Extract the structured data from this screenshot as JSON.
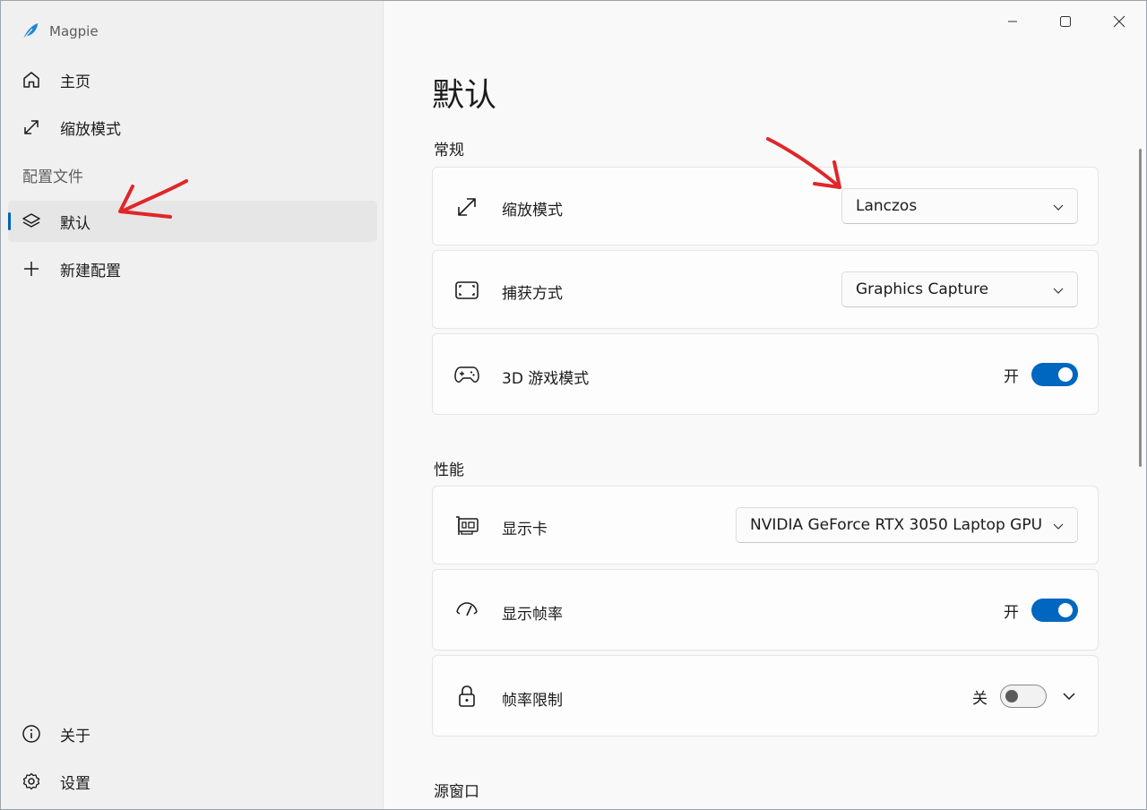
{
  "app": {
    "title": "Magpie"
  },
  "sidebar": {
    "items": [
      {
        "label": "主页",
        "icon": "home-icon"
      },
      {
        "label": "缩放模式",
        "icon": "expand-icon"
      }
    ],
    "section_header": "配置文件",
    "profiles": [
      {
        "label": "默认",
        "icon": "layers-icon",
        "selected": true
      },
      {
        "label": "新建配置",
        "icon": "plus-icon"
      }
    ],
    "footer": [
      {
        "label": "关于",
        "icon": "info-icon"
      },
      {
        "label": "设置",
        "icon": "gear-icon"
      }
    ]
  },
  "main": {
    "title": "默认",
    "sections": {
      "general": "常规",
      "performance": "性能",
      "source_window": "源窗口"
    },
    "settings": {
      "scale_mode": {
        "label": "缩放模式",
        "value": "Lanczos"
      },
      "capture_method": {
        "label": "捕获方式",
        "value": "Graphics Capture"
      },
      "game_mode_3d": {
        "label": "3D 游戏模式",
        "state": "开",
        "on": true
      },
      "gpu": {
        "label": "显示卡",
        "value": "NVIDIA GeForce RTX 3050 Laptop GPU"
      },
      "show_fps": {
        "label": "显示帧率",
        "state": "开",
        "on": true
      },
      "fps_limit": {
        "label": "帧率限制",
        "state": "关",
        "on": false
      }
    }
  },
  "colors": {
    "accent": "#0067c0",
    "annotation": "#e0262a"
  }
}
